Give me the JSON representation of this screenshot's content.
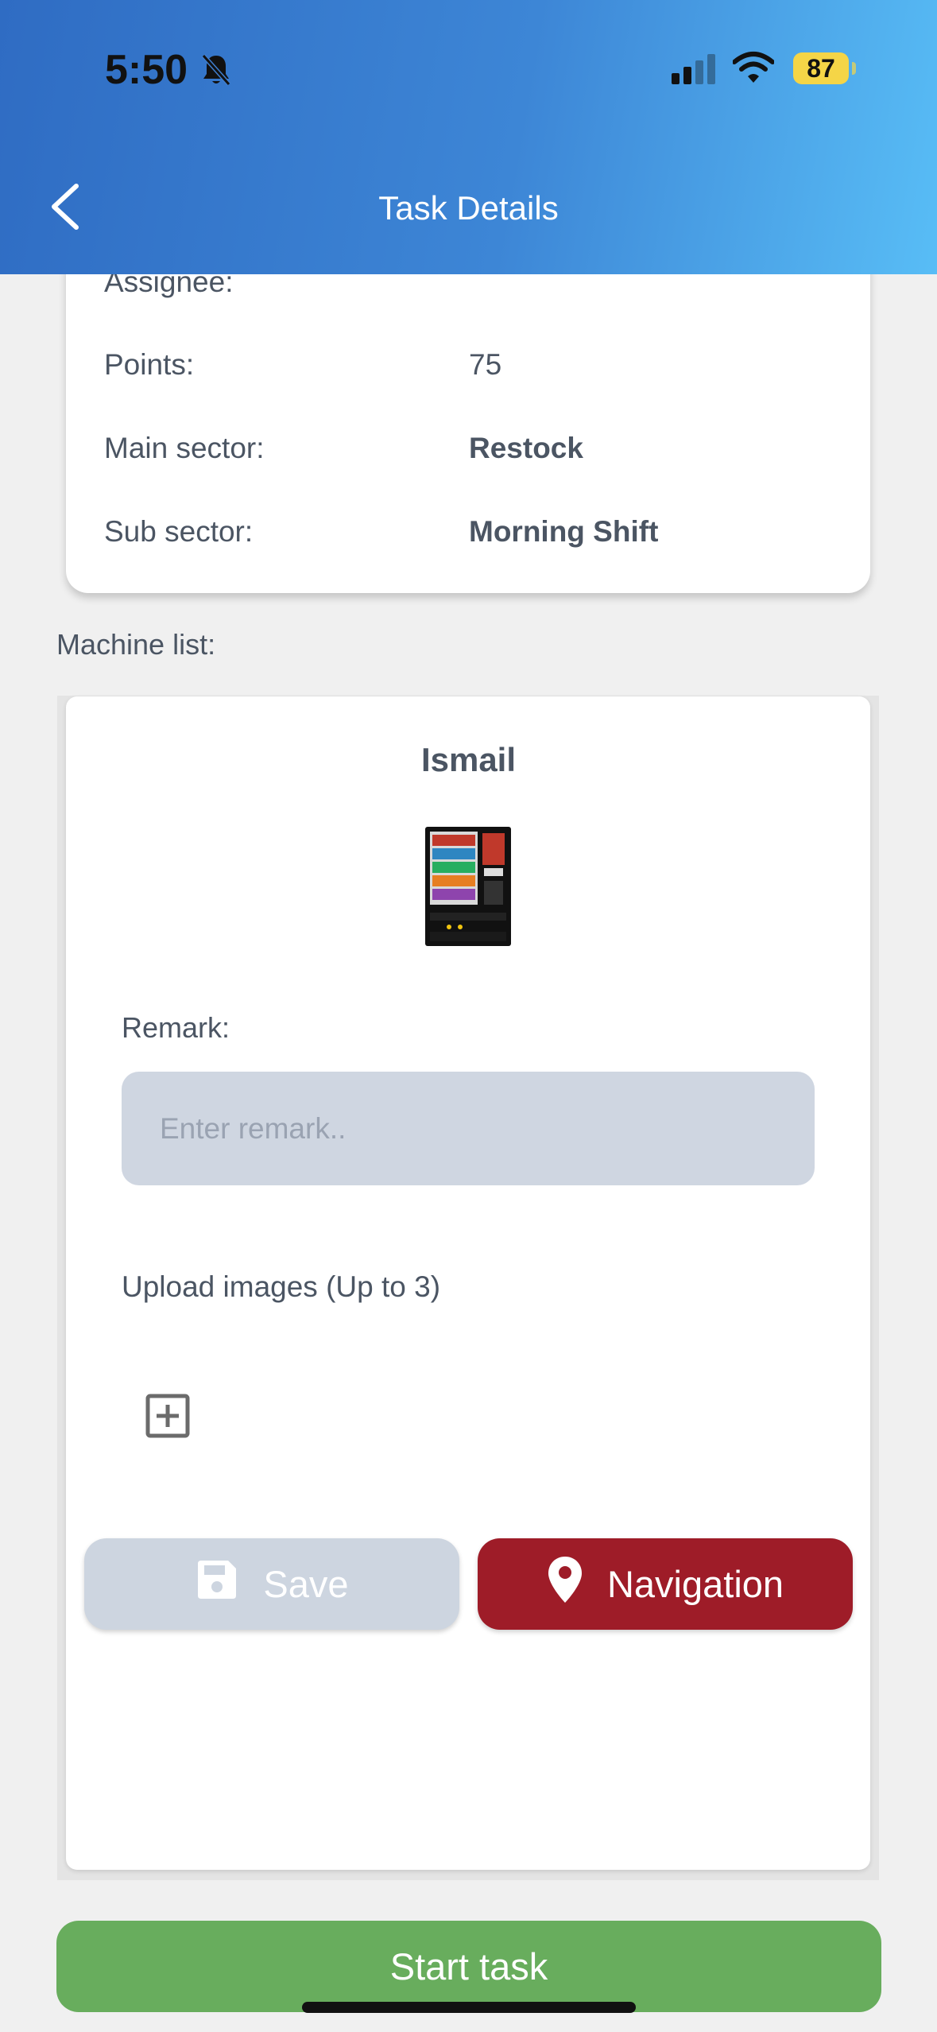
{
  "status_bar": {
    "time": "5:50",
    "battery": "87"
  },
  "header": {
    "title": "Task Details"
  },
  "details": {
    "assignee_label": "Assignee:",
    "points_label": "Points:",
    "points_value": "75",
    "main_sector_label": "Main sector:",
    "main_sector_value": "Restock",
    "sub_sector_label": "Sub sector:",
    "sub_sector_value": "Morning Shift"
  },
  "machine_list": {
    "label": "Machine list:",
    "machine": {
      "name": "Ismail",
      "remark_label": "Remark:",
      "remark_placeholder": "Enter remark..",
      "remark_value": "",
      "upload_label": "Upload images (Up to 3)",
      "save_label": "Save",
      "navigation_label": "Navigation"
    }
  },
  "footer": {
    "start_label": "Start task"
  },
  "colors": {
    "header_start": "#2f6cc3",
    "header_end": "#58bdf6",
    "navigation_button": "#9e1c28",
    "save_button_disabled": "#cdd5e0",
    "start_button": "#68ad5d"
  }
}
